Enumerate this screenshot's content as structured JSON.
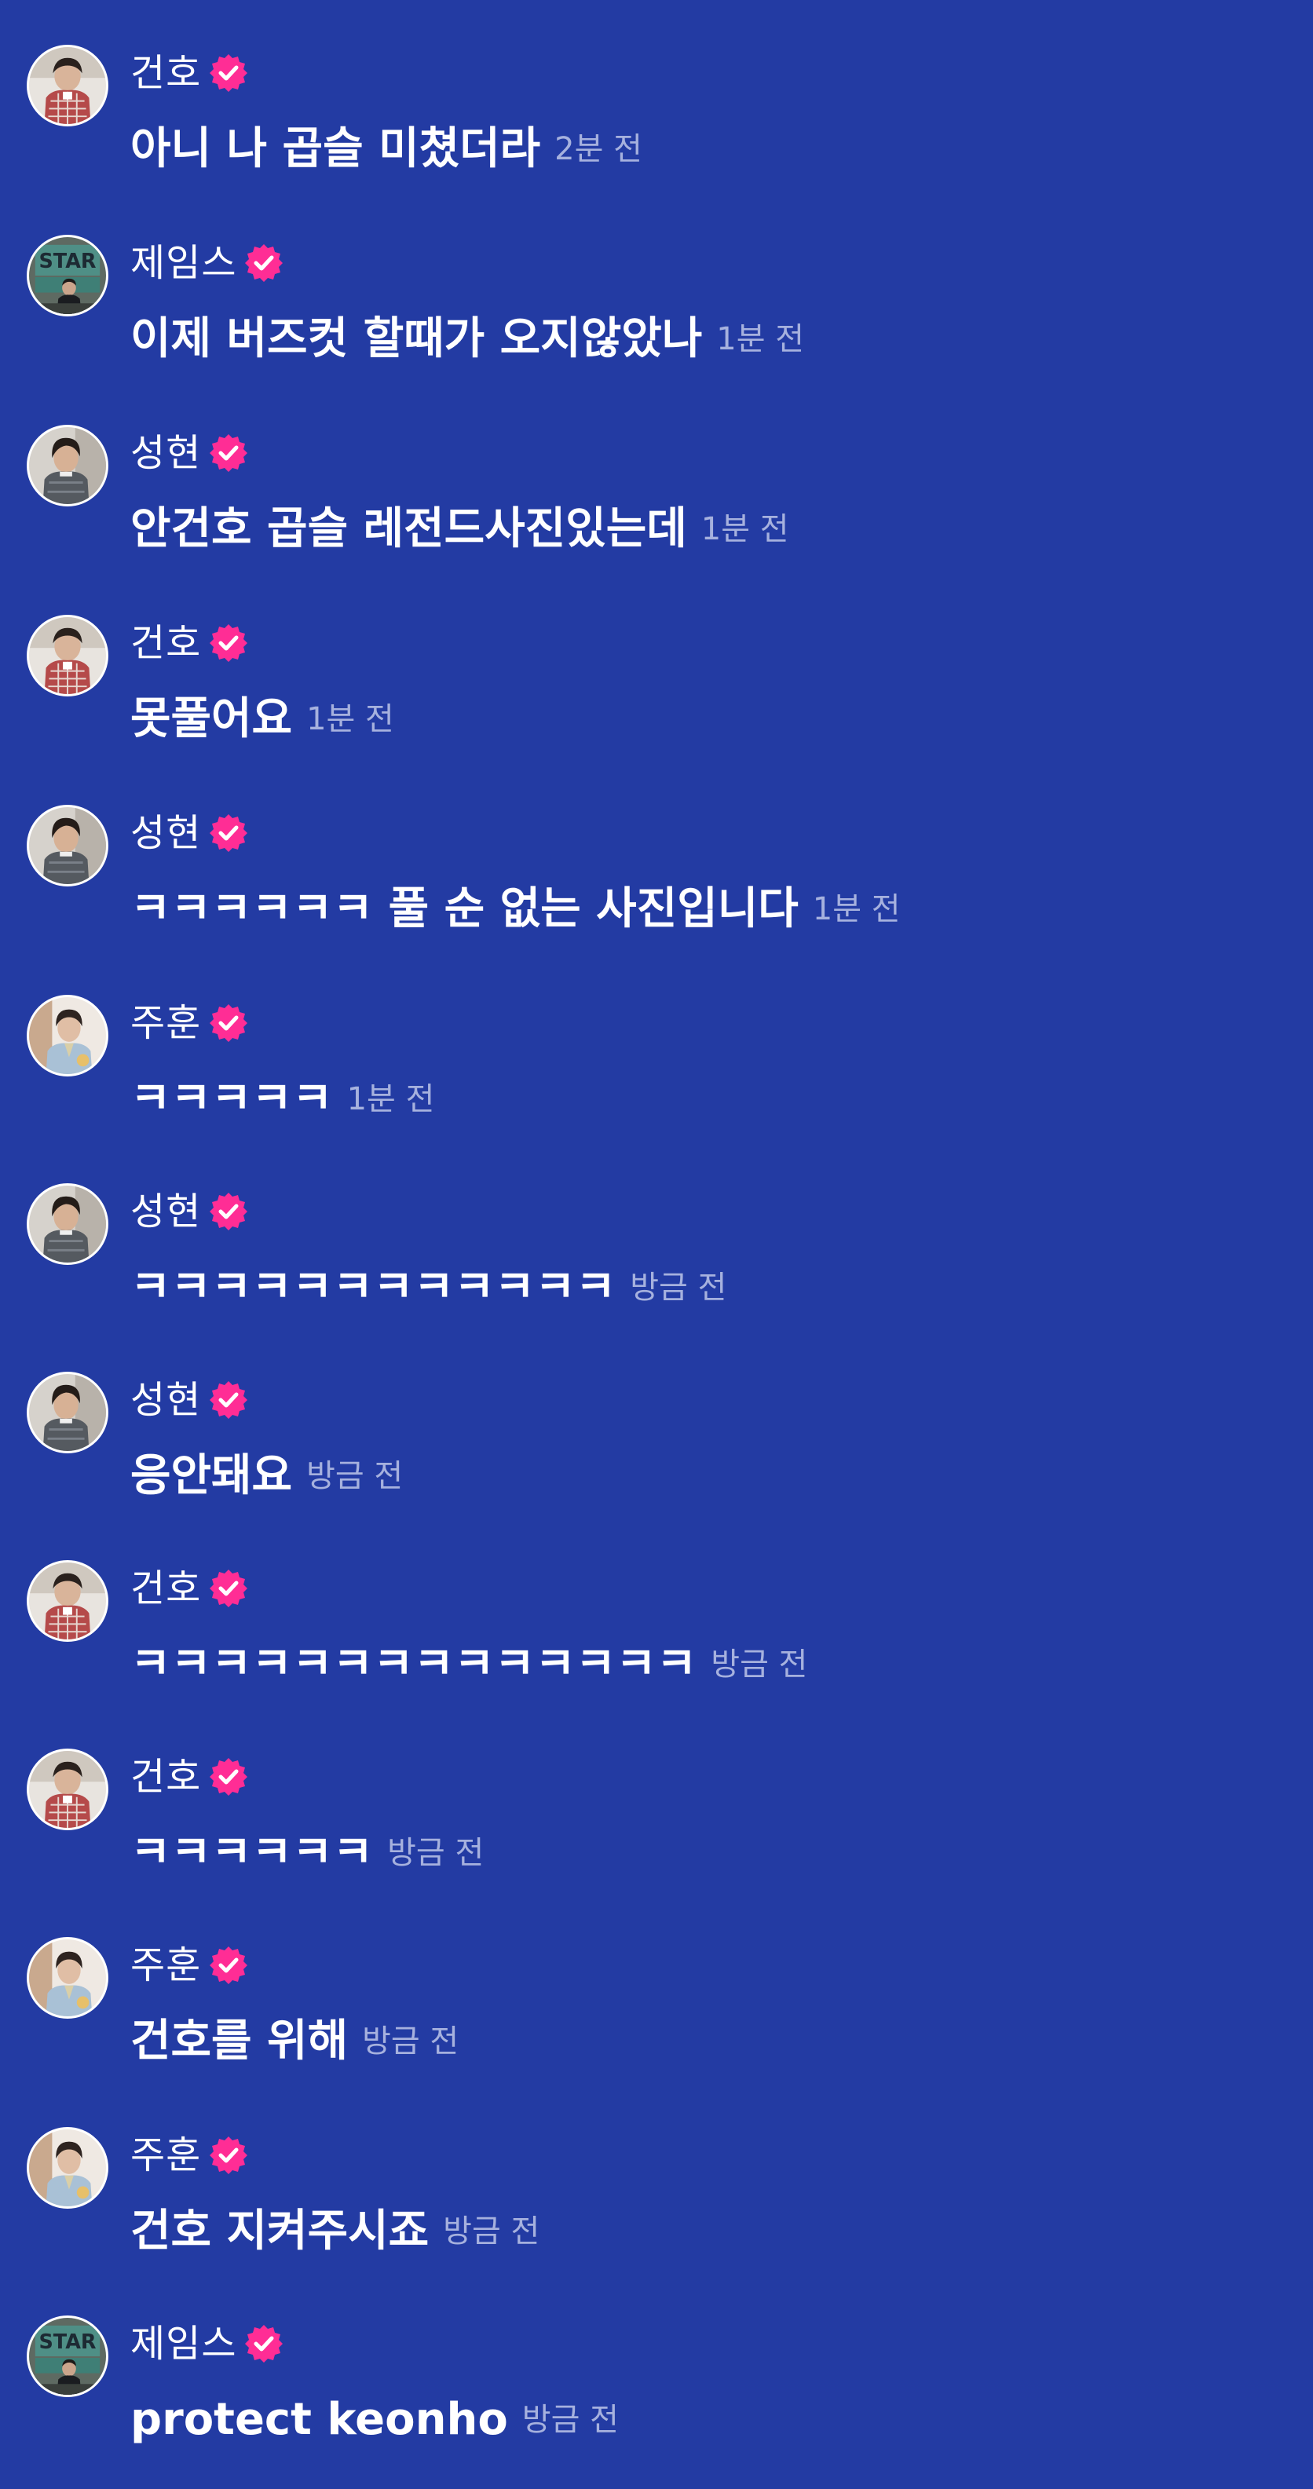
{
  "colors": {
    "background": "#233ba3",
    "text": "#ffffff",
    "timestamp": "#a6b1de",
    "badge": "#ff2d95"
  },
  "icons": {
    "badge": "verified-check-icon"
  },
  "messages": [
    {
      "name": "건호",
      "text": "아니 나 곱슬 미쳤더라",
      "time": "2분 전",
      "avatar": "keonho"
    },
    {
      "name": "제임스",
      "text": "이제 버즈컷 할때가 오지않았나",
      "time": "1분 전",
      "avatar": "james"
    },
    {
      "name": "성현",
      "text": "안건호 곱슬 레전드사진있는데",
      "time": "1분 전",
      "avatar": "sunghyun"
    },
    {
      "name": "건호",
      "text": "못풀어요",
      "time": "1분 전",
      "avatar": "keonho"
    },
    {
      "name": "성현",
      "text": "ㅋㅋㅋㅋㅋㅋ 풀 순 없는 사진입니다",
      "time": "1분 전",
      "avatar": "sunghyun"
    },
    {
      "name": "주훈",
      "text": "ㅋㅋㅋㅋㅋ",
      "time": "1분 전",
      "avatar": "juhoon"
    },
    {
      "name": "성현",
      "text": "ㅋㅋㅋㅋㅋㅋㅋㅋㅋㅋㅋㅋ",
      "time": "방금 전",
      "avatar": "sunghyun"
    },
    {
      "name": "성현",
      "text": "응안돼요",
      "time": "방금 전",
      "avatar": "sunghyun"
    },
    {
      "name": "건호",
      "text": "ㅋㅋㅋㅋㅋㅋㅋㅋㅋㅋㅋㅋㅋㅋ",
      "time": "방금 전",
      "avatar": "keonho"
    },
    {
      "name": "건호",
      "text": "ㅋㅋㅋㅋㅋㅋ",
      "time": "방금 전",
      "avatar": "keonho"
    },
    {
      "name": "주훈",
      "text": "건호를 위해",
      "time": "방금 전",
      "avatar": "juhoon"
    },
    {
      "name": "주훈",
      "text": "건호 지켜주시죠",
      "time": "방금 전",
      "avatar": "juhoon"
    },
    {
      "name": "제임스",
      "text": "protect keonho",
      "time": "방금 전",
      "avatar": "james"
    }
  ]
}
